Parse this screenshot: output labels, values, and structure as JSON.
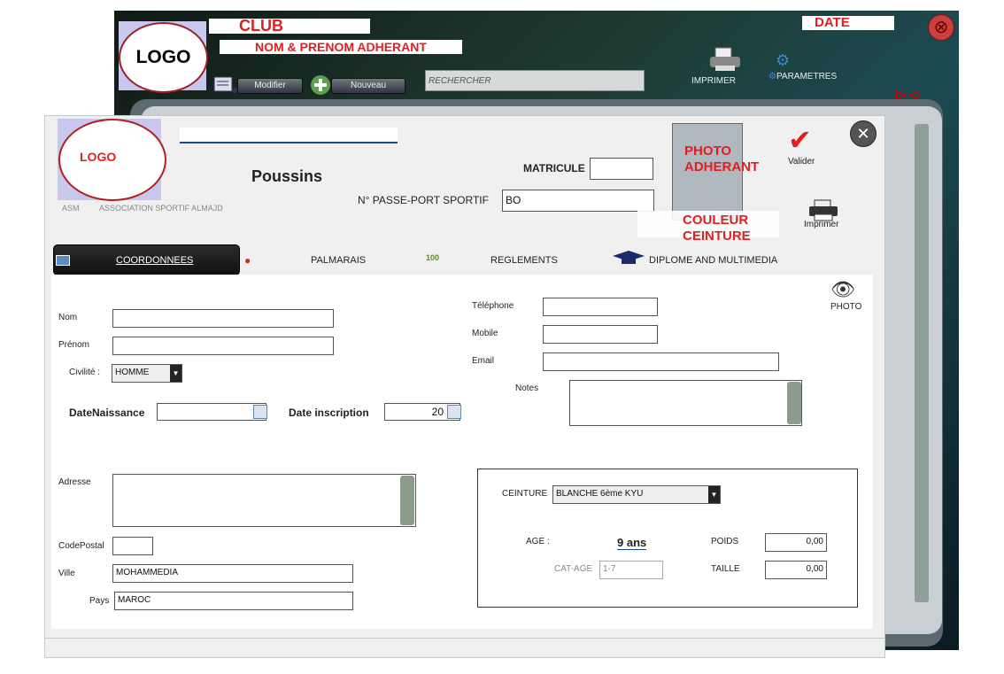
{
  "background_window": {
    "logo": "LOGO",
    "club": "CLUB",
    "date": "DATE",
    "member_name": "NOM & PRENOM ADHERANT",
    "buttons": {
      "modifier": "Modifier",
      "nouveau": "Nouveau"
    },
    "search_placeholder": "RECHERCHER",
    "imprimer": "IMPRIMER",
    "parametres": "PARAMETRES"
  },
  "dialog": {
    "logo": "LOGO",
    "club_abbrev": "ASM",
    "club_name": "ASSOCIATION SPORTIF ALMAJD",
    "category": "Poussins",
    "matricule_label": "MATRICULE",
    "matricule_value": "",
    "passport_label": "N° PASSE-PORT SPORTIF",
    "passport_value": "BO",
    "photo_text": "PHOTO ADHERANT",
    "belt_color_text": "COULEUR CEINTURE",
    "valider": "Valider",
    "imprimer": "Imprimer"
  },
  "tabs": [
    {
      "label": "COORDONNEES",
      "active": true
    },
    {
      "label": "PALMARAIS",
      "active": false
    },
    {
      "label": "REGLEMENTS",
      "active": false
    },
    {
      "label": "DIPLOME AND MULTIMEDIA",
      "active": false
    }
  ],
  "form": {
    "nom_label": "Nom",
    "prenom_label": "Prénom",
    "civilite_label": "Civilité :",
    "civilite_value": "HOMME",
    "date_naissance_label": "DateNaissance",
    "date_inscription_label": "Date inscription",
    "date_inscription_value": "20",
    "telephone_label": "Téléphone",
    "mobile_label": "Mobile",
    "email_label": "Email",
    "notes_label": "Notes",
    "photo_label": "PHOTO",
    "adresse_label": "Adresse",
    "codepostal_label": "CodePostal",
    "ville_label": "Ville",
    "ville_value": "MOHAMMEDIA",
    "pays_label": "Pays",
    "pays_value": "MAROC"
  },
  "belt_panel": {
    "ceinture_label": "CEINTURE",
    "ceinture_value": "BLANCHE 6ème  KYU",
    "age_label": "AGE :",
    "age_value": "9 ans",
    "cat_age_label": "CAT-AGE",
    "cat_age_value": "1-7",
    "poids_label": "POIDS",
    "poids_value": "0,00",
    "taille_label": "TAILLE",
    "taille_value": "0,00"
  },
  "colors": {
    "accent_red": "#e02020",
    "tab_dark": "#1a1a1a"
  }
}
